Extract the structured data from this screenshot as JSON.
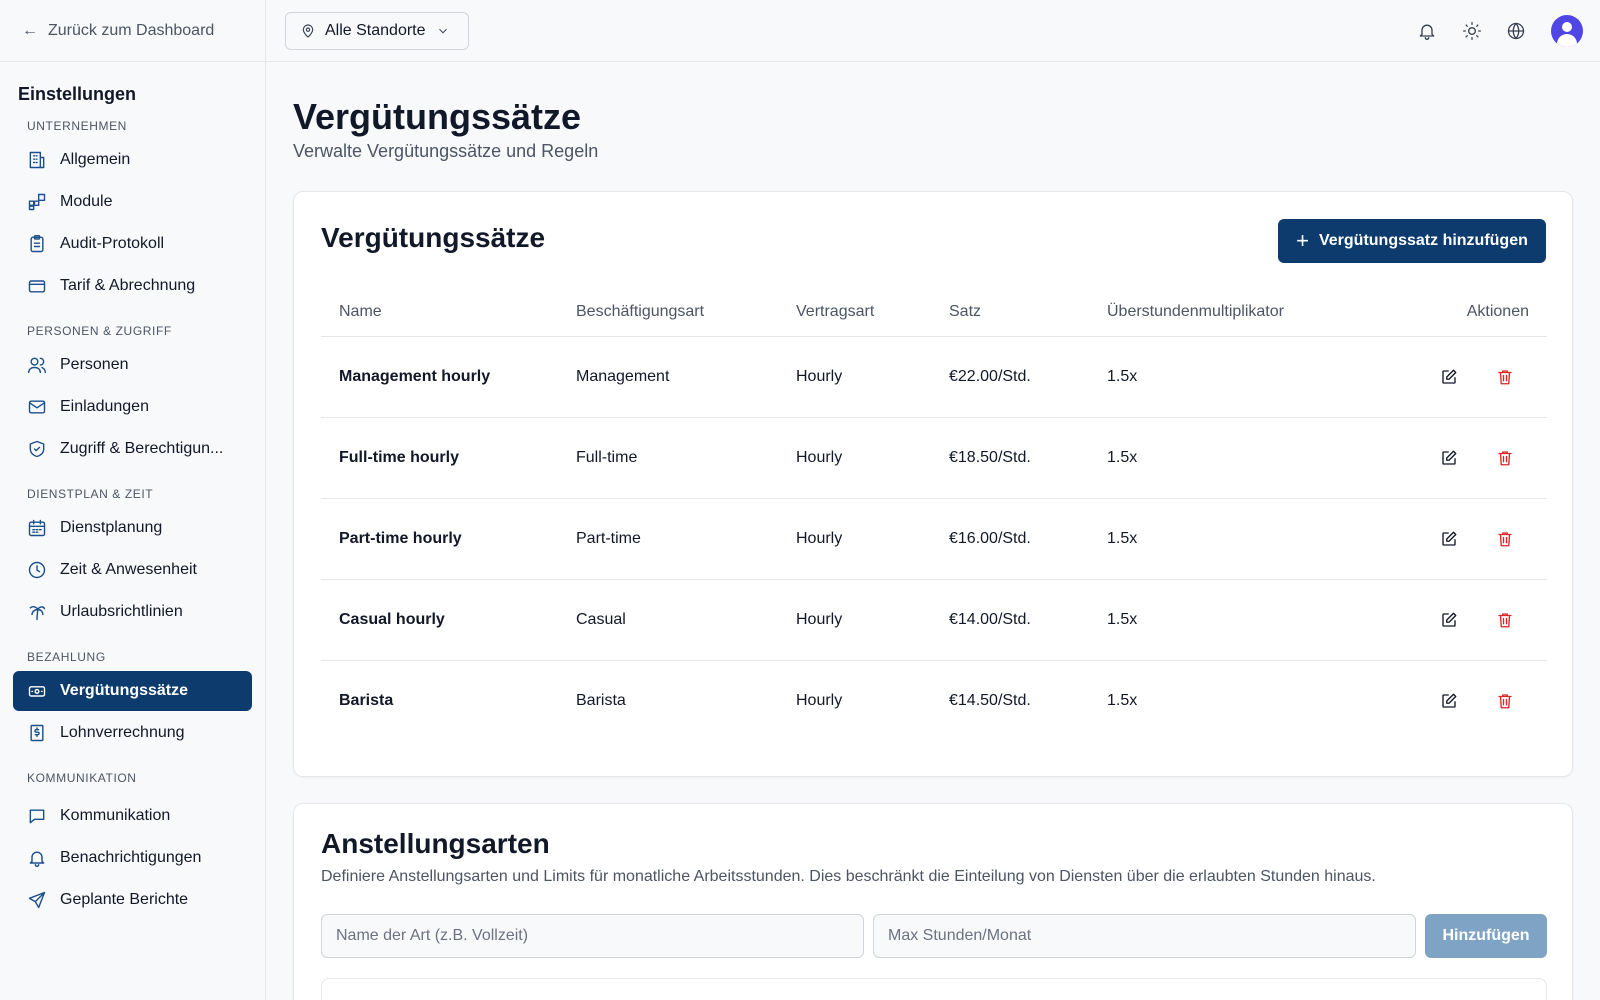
{
  "sidebar": {
    "back_label": "Zurück zum Dashboard",
    "title": "Einstellungen",
    "sections": {
      "company": "UNTERNEHMEN",
      "people": "PERSONEN & ZUGRIFF",
      "schedule": "DIENSTPLAN & ZEIT",
      "payment": "BEZAHLUNG",
      "communication": "KOMMUNIKATION"
    },
    "items": {
      "general": "Allgemein",
      "modules": "Module",
      "audit": "Audit-Protokoll",
      "billing": "Tarif & Abrechnung",
      "people": "Personen",
      "invitations": "Einladungen",
      "access": "Zugriff & Berechtigun...",
      "scheduling": "Dienstplanung",
      "time": "Zeit & Anwesenheit",
      "leave": "Urlaubsrichtlinien",
      "pay_rates": "Vergütungssätze",
      "payroll": "Lohnverrechnung",
      "communication": "Kommunikation",
      "notifications": "Benachrichtigungen",
      "reports": "Geplante Berichte"
    }
  },
  "topbar": {
    "location": "Alle Standorte"
  },
  "page": {
    "title": "Vergütungssätze",
    "subtitle": "Verwalte Vergütungssätze und Regeln"
  },
  "rates_card": {
    "title": "Vergütungssätze",
    "add_button": "Vergütungssatz hinzufügen",
    "columns": {
      "name": "Name",
      "employment_type": "Beschäftigungsart",
      "contract_type": "Vertragsart",
      "rate": "Satz",
      "overtime": "Überstundenmultiplikator",
      "actions": "Aktionen"
    },
    "rows": [
      {
        "name": "Management hourly",
        "employment_type": "Management",
        "contract_type": "Hourly",
        "rate": "€22.00/Std.",
        "overtime": "1.5x"
      },
      {
        "name": "Full-time hourly",
        "employment_type": "Full-time",
        "contract_type": "Hourly",
        "rate": "€18.50/Std.",
        "overtime": "1.5x"
      },
      {
        "name": "Part-time hourly",
        "employment_type": "Part-time",
        "contract_type": "Hourly",
        "rate": "€16.00/Std.",
        "overtime": "1.5x"
      },
      {
        "name": "Casual hourly",
        "employment_type": "Casual",
        "contract_type": "Hourly",
        "rate": "€14.00/Std.",
        "overtime": "1.5x"
      },
      {
        "name": "Barista",
        "employment_type": "Barista",
        "contract_type": "Hourly",
        "rate": "€14.50/Std.",
        "overtime": "1.5x"
      }
    ]
  },
  "employment_card": {
    "title": "Anstellungsarten",
    "description": "Definiere Anstellungsarten und Limits für monatliche Arbeitsstunden. Dies beschränkt die Einteilung von Diensten über die erlaubten Stunden hinaus.",
    "name_placeholder": "Name der Art (z.B. Vollzeit)",
    "hours_placeholder": "Max Stunden/Monat",
    "add_button": "Hinzufügen"
  },
  "colors": {
    "primary": "#0d3b6e",
    "primary_disabled": "#7fa3c4",
    "danger": "#dc2626",
    "avatar": "#4f46e5"
  }
}
